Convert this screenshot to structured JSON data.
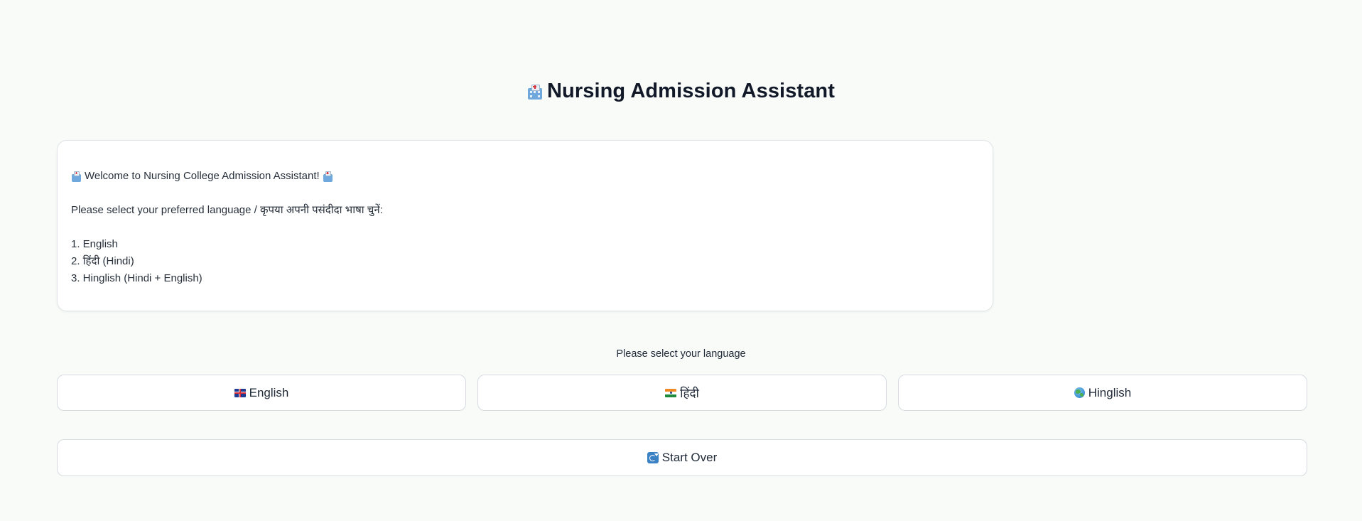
{
  "header": {
    "title": "Nursing Admission Assistant",
    "icon": "hospital-icon"
  },
  "message": {
    "welcome": "Welcome to Nursing College Admission Assistant!",
    "instruction": "Please select your preferred language / कृपया अपनी पसंदीदा भाषा चुनें:",
    "options": [
      "1. English",
      "2. हिंदी (Hindi)",
      "3. Hinglish (Hindi + English)"
    ]
  },
  "language_prompt": "Please select your language",
  "buttons": {
    "english": {
      "label": "English",
      "icon": "uk-flag-icon"
    },
    "hindi": {
      "label": "हिंदी",
      "icon": "india-flag-icon"
    },
    "hinglish": {
      "label": "Hinglish",
      "icon": "globe-icon"
    },
    "restart": {
      "label": "Start Over",
      "icon": "refresh-icon"
    }
  },
  "colors": {
    "background": "#f9fbf9",
    "title": "#111827",
    "card_border": "#e2e5e9",
    "button_border": "#d7dbe0"
  }
}
